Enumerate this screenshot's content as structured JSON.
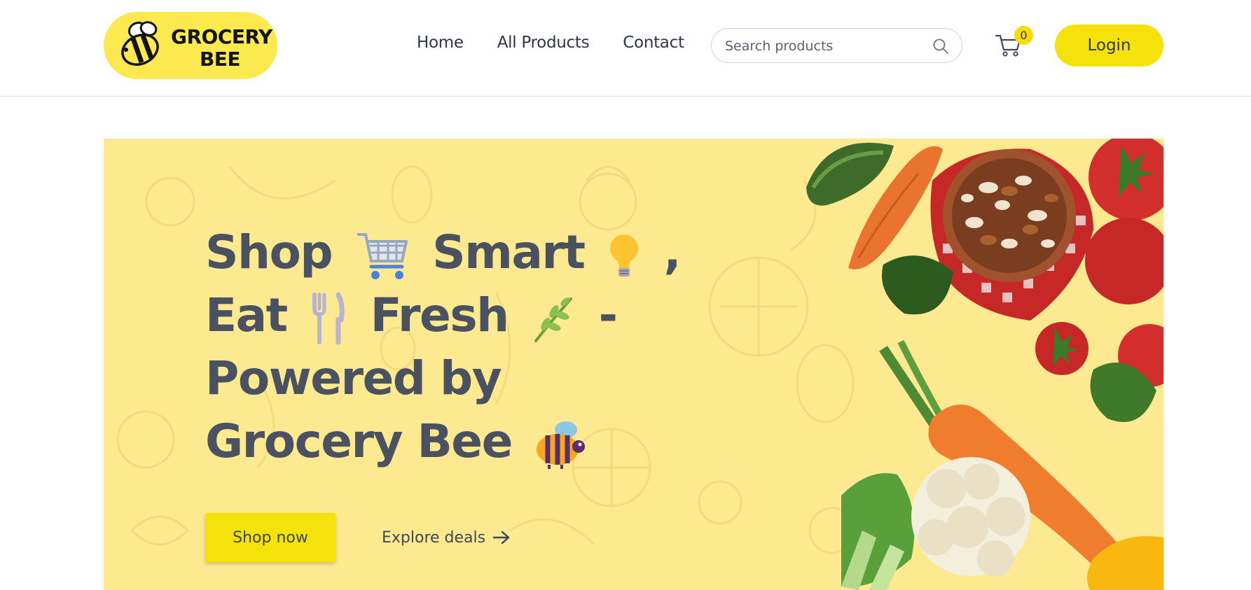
{
  "brand": {
    "logo_line1": "GROCERY",
    "logo_line2": "BEE",
    "accent_color": "#f5e20a",
    "logo_bg": "#fce94f"
  },
  "nav": {
    "items": [
      {
        "label": "Home"
      },
      {
        "label": "All Products"
      },
      {
        "label": "Contact"
      }
    ]
  },
  "search": {
    "placeholder": "Search products",
    "value": "",
    "icon": "search-icon"
  },
  "cart": {
    "icon": "cart-icon",
    "count": "0"
  },
  "auth": {
    "login_label": "Login"
  },
  "hero": {
    "bg_color": "#fde990",
    "headline": {
      "line1_a": "Shop",
      "line1_b": "Smart",
      "line1_c": ",",
      "line2_a": "Eat",
      "line2_b": "Fresh",
      "line2_c": "-",
      "line3": "Powered by",
      "line4": "Grocery Bee"
    },
    "emojis": [
      "shopping-cart-icon",
      "lightbulb-icon",
      "fork-knife-icon",
      "herb-icon",
      "bee-icon"
    ],
    "shop_now_label": "Shop now",
    "explore_label": "Explore deals"
  }
}
